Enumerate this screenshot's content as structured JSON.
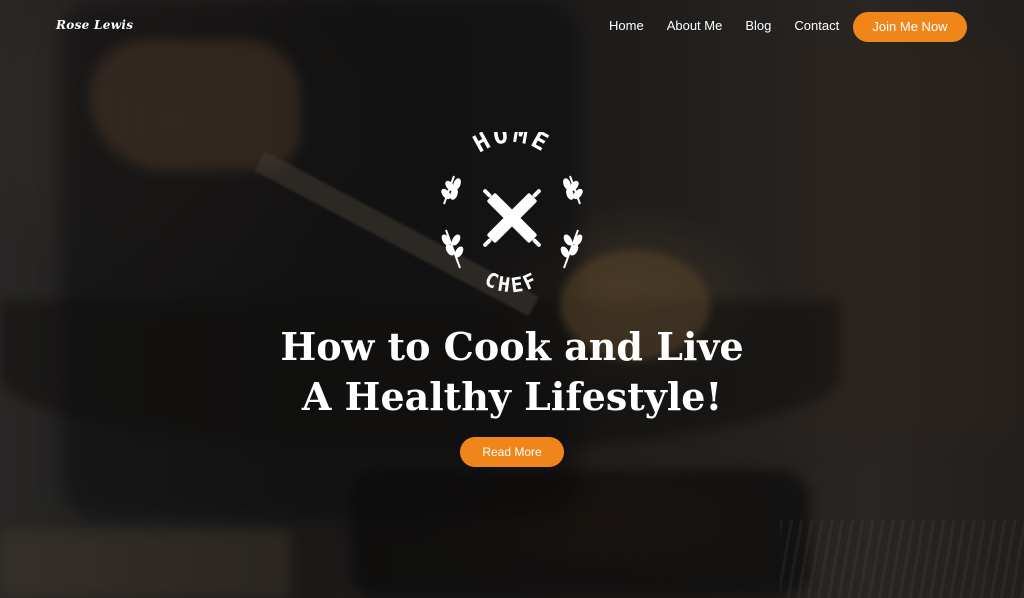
{
  "brand": {
    "name": "Rose Lewis"
  },
  "nav": {
    "items": [
      {
        "label": "Home"
      },
      {
        "label": "About Me"
      },
      {
        "label": "Blog"
      },
      {
        "label": "Contact"
      }
    ],
    "cta_label": "Join Me Now"
  },
  "logo": {
    "top_text": "HOME",
    "bottom_text": "CHEF",
    "icon": "crossed-rolling-pins-icon"
  },
  "hero": {
    "headline_line1": "How to Cook and Live",
    "headline_line2": "A Healthy Lifestyle!",
    "button_label": "Read More"
  },
  "colors": {
    "accent": "#f0861a",
    "text": "#ffffff"
  }
}
